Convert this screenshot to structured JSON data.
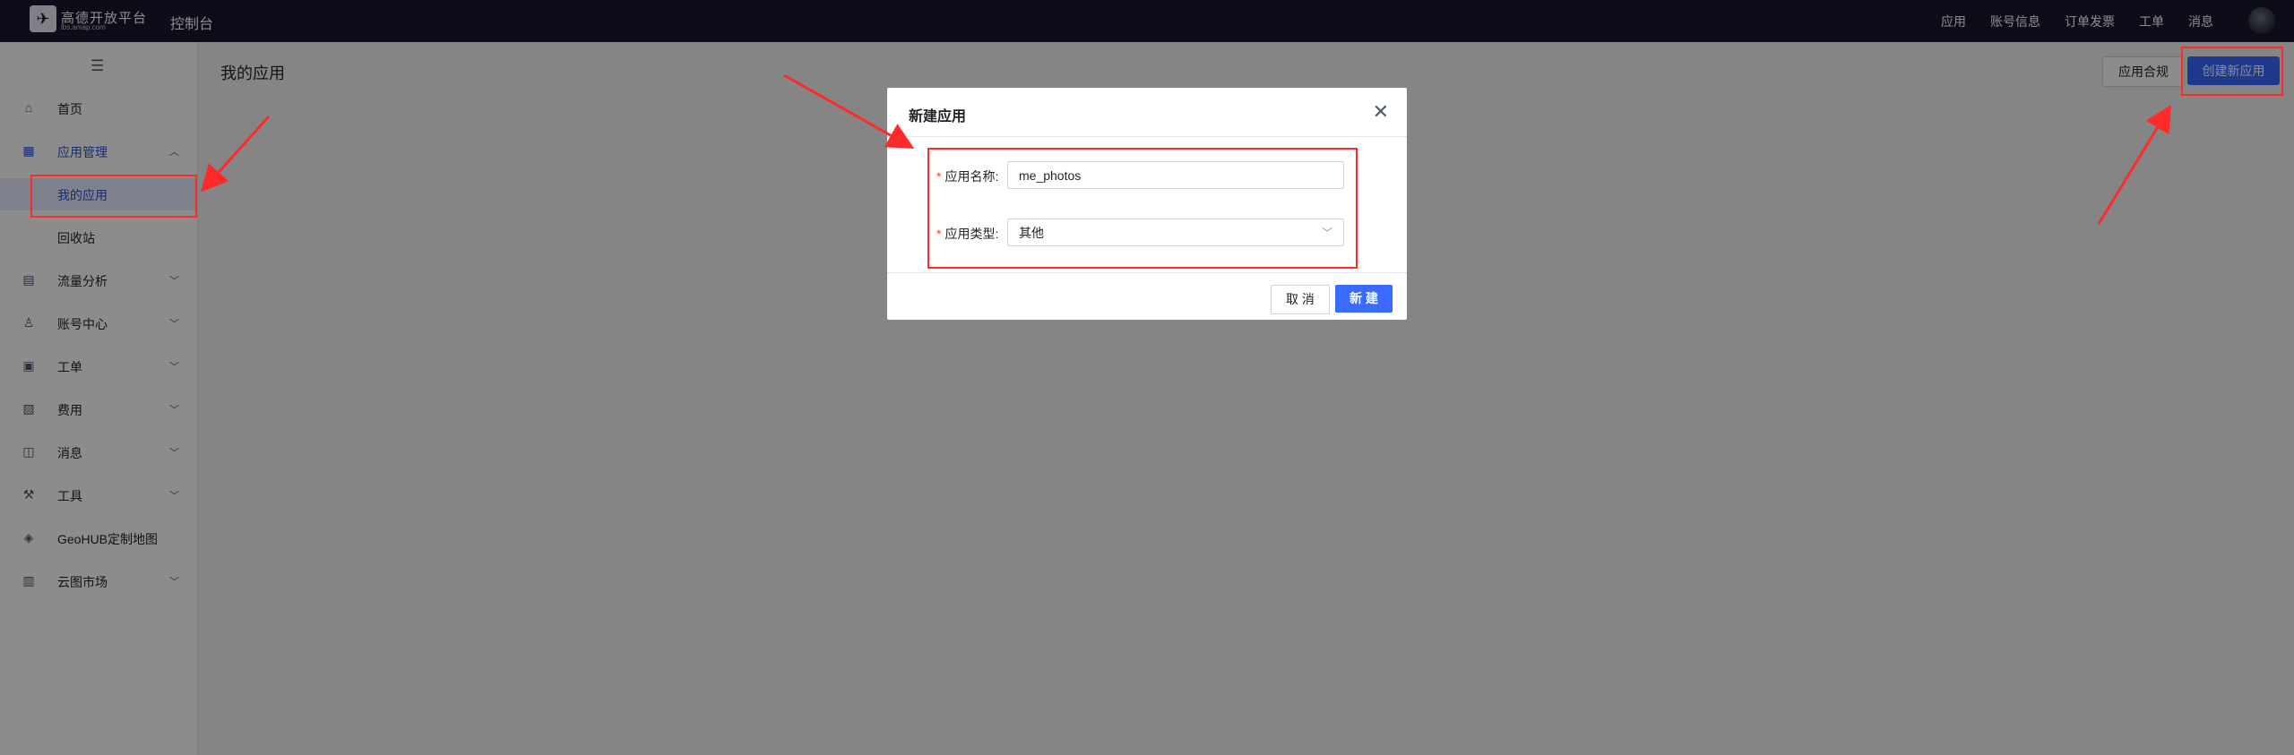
{
  "topbar": {
    "logo_text": "高德开放平台",
    "logo_sub": "lbs.amap.com",
    "console": "控制台",
    "nav": [
      "应用",
      "账号信息",
      "订单发票",
      "工单",
      "消息"
    ]
  },
  "sidebar": {
    "collapse_icon": "☰",
    "items": [
      {
        "label": "首页",
        "icon": "home-icon"
      },
      {
        "label": "应用管理",
        "icon": "grid-icon"
      },
      {
        "label": "我的应用"
      },
      {
        "label": "回收站"
      },
      {
        "label": "流量分析",
        "icon": "chart-icon"
      },
      {
        "label": "账号中心",
        "icon": "user-icon"
      },
      {
        "label": "工单",
        "icon": "ticket-icon"
      },
      {
        "label": "费用",
        "icon": "fee-icon"
      },
      {
        "label": "消息",
        "icon": "message-icon"
      },
      {
        "label": "工具",
        "icon": "tool-icon"
      },
      {
        "label": "GeoHUB定制地图",
        "icon": "layers-icon"
      },
      {
        "label": "云图市场",
        "icon": "store-icon"
      }
    ]
  },
  "main": {
    "title": "我的应用",
    "compliance_btn": "应用合规",
    "create_btn": "创建新应用"
  },
  "modal": {
    "title": "新建应用",
    "name_label": "应用名称:",
    "name_value": "me_photos",
    "type_label": "应用类型:",
    "type_value": "其他",
    "cancel": "取 消",
    "ok": "新 建"
  },
  "colors": {
    "primary": "#3a6bff",
    "topbar": "#17192f",
    "annotation": "#ff2a2a"
  }
}
